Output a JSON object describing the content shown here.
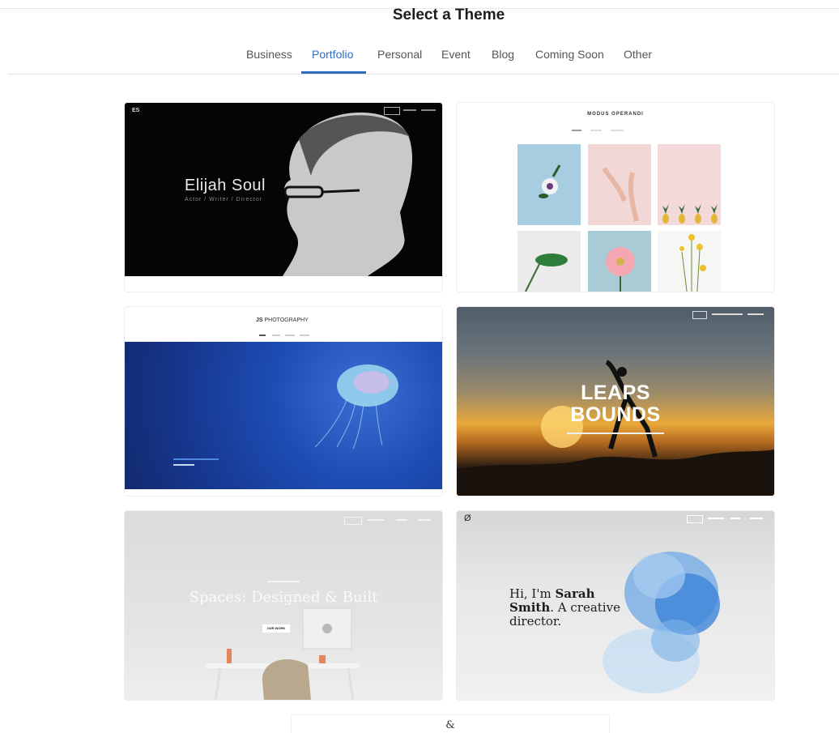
{
  "header": {
    "title": "Select a Theme"
  },
  "tabs": [
    {
      "label": "Business",
      "active": false
    },
    {
      "label": "Portfolio",
      "active": true
    },
    {
      "label": "Personal",
      "active": false
    },
    {
      "label": "Event",
      "active": false
    },
    {
      "label": "Blog",
      "active": false
    },
    {
      "label": "Coming Soon",
      "active": false
    },
    {
      "label": "Other",
      "active": false
    }
  ],
  "colors": {
    "accent": "#2f6cc2"
  },
  "themes": [
    {
      "logo": "ES",
      "name": "Elijah Soul",
      "subtitle": "Actor / Writer / Director"
    },
    {
      "brand": "MODUS OPERANDI"
    },
    {
      "brand": "PHOTOGRAPHY",
      "brand_mark": "JS"
    },
    {
      "line1": "LEAPS",
      "line2": "BOUNDS"
    },
    {
      "heading": "Spaces: Designed & Built",
      "button": "OUR WORK"
    },
    {
      "mark": "Ø",
      "greeting_pre": "Hi, I'm ",
      "greeting_name": "Sarah Smith",
      "greeting_post": ". A creative director."
    },
    {
      "brand": "&"
    }
  ]
}
